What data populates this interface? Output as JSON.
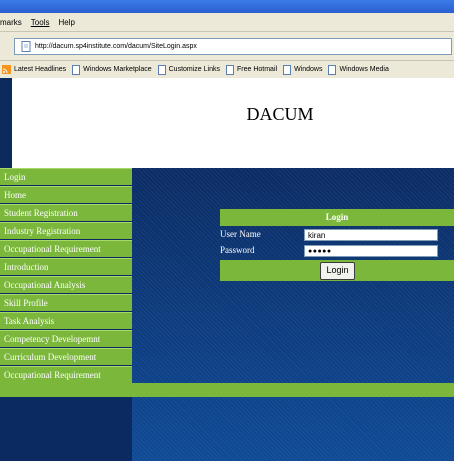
{
  "browser": {
    "menu": [
      "marks",
      "Tools",
      "Help"
    ],
    "address": "http://dacum.sp4institute.com/dacum/SiteLogin.aspx",
    "links": [
      "Latest Headlines",
      "Windows Marketplace",
      "Customize Links",
      "Free Hotmail",
      "Windows",
      "Windows Media"
    ]
  },
  "page": {
    "title": "DACUM",
    "nav": [
      "Login",
      "Home",
      "Student Registration",
      "Industry Registration",
      "Occupational Requirement",
      "Introduction",
      "Occupational Analysis",
      "Skill Profile",
      "Task Analysis",
      "Competency Developemnt",
      "Curriculum Development",
      "Occupational Requirement"
    ],
    "login": {
      "heading": "Login",
      "username_label": "User Name",
      "username_value": "kiran",
      "password_label": "Password",
      "password_value": "●●●●●",
      "button_label": "Login"
    }
  },
  "colors": {
    "accent_green": "#7ab73b",
    "navy": "#0c3070"
  }
}
